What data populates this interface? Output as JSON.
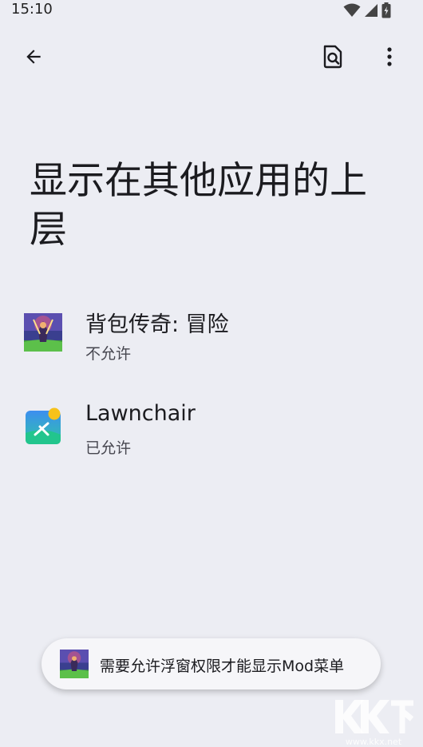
{
  "status_bar": {
    "time": "15:10",
    "icons": [
      "wifi-icon",
      "cell-signal-icon",
      "battery-charging-icon"
    ]
  },
  "app_bar": {
    "back_icon": "arrow-back-icon",
    "search_icon": "search-document-icon",
    "more_icon": "more-vert-icon"
  },
  "page": {
    "title": "显示在其他应用的上层"
  },
  "apps": [
    {
      "name": "背包传奇: 冒险",
      "status": "不允许",
      "icon": "game-app-icon"
    },
    {
      "name": "Lawnchair",
      "status": "已允许",
      "icon": "lawnchair-app-icon"
    }
  ],
  "toast": {
    "text": "需要允许浮窗权限才能显示Mod菜单",
    "icon": "game-app-icon"
  },
  "watermark": {
    "logo_text": "KK下载",
    "url": "www.kkx.net"
  },
  "colors": {
    "background": "#ecedf3",
    "toast_background": "#f6f6f9",
    "lawnchair_bg": "#22c58d",
    "lawnchair_sun": "#f6c21b"
  }
}
